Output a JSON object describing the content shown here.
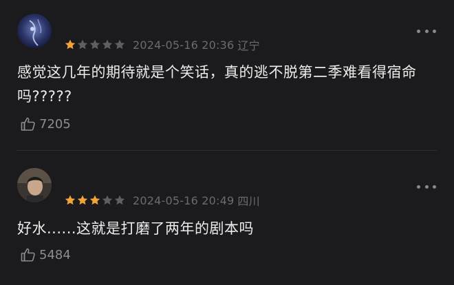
{
  "comments": [
    {
      "rating": 1,
      "max_rating": 5,
      "date": "2024-05-16 20:36",
      "location": "辽宁",
      "text": "感觉这几年的期待就是个笑话，真的逃不脱第二季难看得宿命吗?????",
      "likes": "7205"
    },
    {
      "rating": 3,
      "max_rating": 5,
      "date": "2024-05-16 20:49",
      "location": "四川",
      "text": "好水......这就是打磨了两年的剧本吗",
      "likes": "5484"
    }
  ],
  "colors": {
    "background": "#1b1b1d",
    "star_filled": "#f2a33a",
    "star_empty": "#5e5e63",
    "meta_text": "#6b6b70",
    "body_text": "#ececed"
  },
  "icons": {
    "like": "thumbs-up-icon",
    "more": "more-icon"
  }
}
